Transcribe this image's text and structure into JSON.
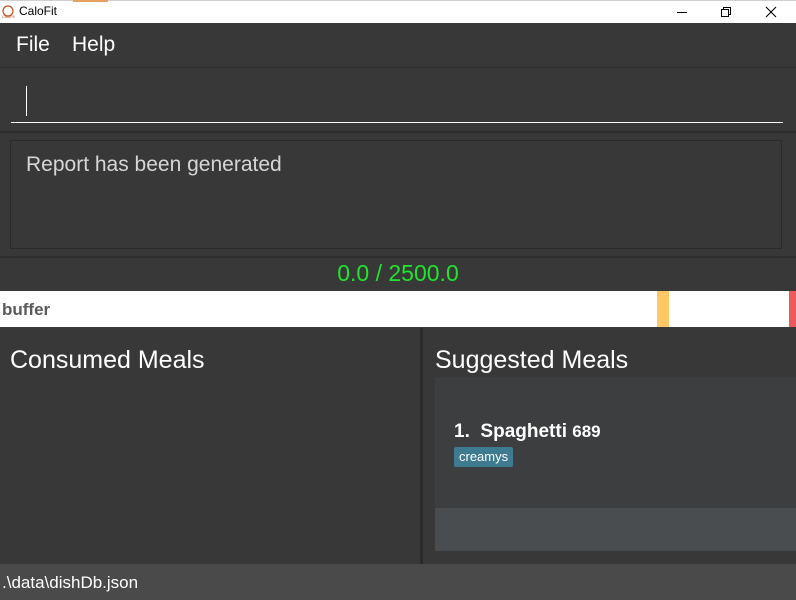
{
  "window": {
    "title": "CaloFit",
    "app_icon": "calofit-logo-icon",
    "controls": [
      "minimize-icon",
      "maximize-icon",
      "close-icon"
    ]
  },
  "menu": {
    "file": "File",
    "help": "Help"
  },
  "command_box": {
    "value": ""
  },
  "result_display": {
    "text": "Report has been generated"
  },
  "calorie_counter": {
    "text": "0.0 / 2500.0",
    "color": "#1ee62a"
  },
  "progress_bar": {
    "label": "buffer",
    "consumed_fraction": 0.0,
    "colors": {
      "buffer": "#ffc765",
      "limit": "#ee5a5a"
    }
  },
  "consumed_meals": {
    "title": "Consumed Meals",
    "items": []
  },
  "suggested_meals": {
    "title": "Suggested Meals",
    "items": [
      {
        "index": "1.",
        "name": "Spaghetti",
        "calories": "689",
        "tags": [
          "creamys"
        ]
      }
    ]
  },
  "status_bar": {
    "path": ".\\data\\dishDb.json"
  }
}
